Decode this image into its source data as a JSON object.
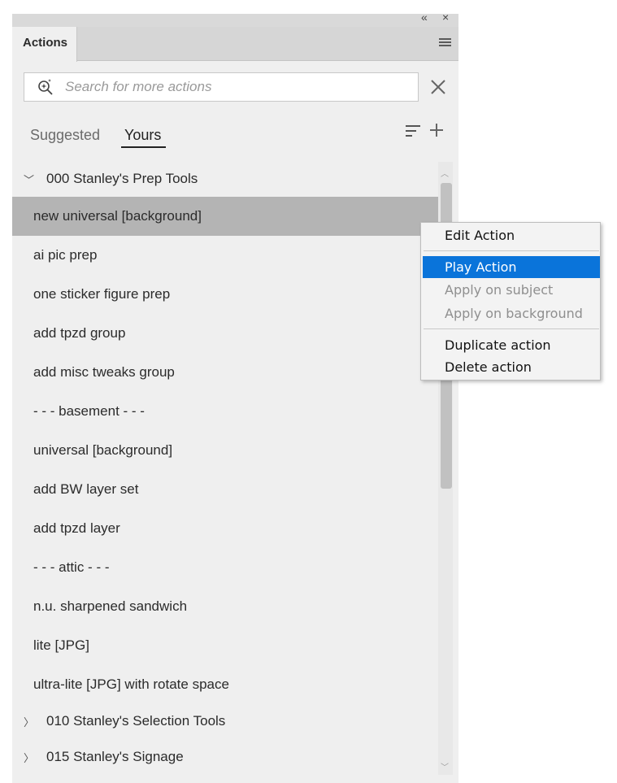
{
  "window": {
    "collapse_glyph": "«",
    "close_glyph": "×"
  },
  "panel": {
    "tab_label": "Actions"
  },
  "search": {
    "placeholder": "Search for more actions",
    "value": ""
  },
  "subtabs": {
    "suggested": "Suggested",
    "yours": "Yours",
    "active": "Yours"
  },
  "sets": {
    "expanded": {
      "label": "000 Stanley's Prep Tools",
      "chevron": "﹀"
    },
    "collapsed_1": {
      "label": "010 Stanley's Selection Tools",
      "chevron": "〉"
    },
    "collapsed_2": {
      "label": "015 Stanley's Signage",
      "chevron": "〉"
    }
  },
  "actions": [
    {
      "label": "new universal [background]",
      "selected": true
    },
    {
      "label": "ai pic prep"
    },
    {
      "label": "one sticker figure prep"
    },
    {
      "label": "add tpzd group"
    },
    {
      "label": "add misc tweaks group"
    },
    {
      "label": "- - - basement - - -"
    },
    {
      "label": "universal [background]"
    },
    {
      "label": "add BW layer set"
    },
    {
      "label": "add tpzd layer"
    },
    {
      "label": "- - - attic - - -"
    },
    {
      "label": "n.u. sharpened sandwich"
    },
    {
      "label": "lite [JPG]"
    },
    {
      "label": "ultra-lite [JPG] with rotate space"
    }
  ],
  "context_menu": {
    "edit": "Edit Action",
    "play": "Play Action",
    "apply_subject": "Apply on subject",
    "apply_background": "Apply on background",
    "duplicate": "Duplicate action",
    "delete": "Delete action"
  },
  "colors": {
    "selection_highlight": "#0a74da",
    "selected_row": "#b4b4b4",
    "panel_bg": "#efefef"
  }
}
